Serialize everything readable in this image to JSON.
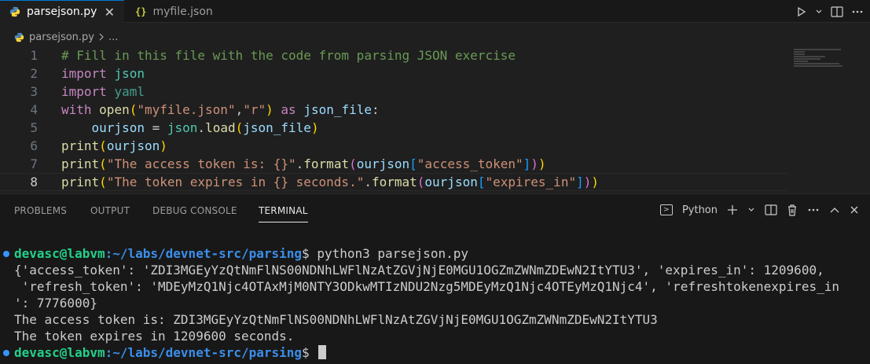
{
  "tabs": [
    {
      "label": "parsejson.py",
      "icon": "python-icon",
      "active": true,
      "close": "✕"
    },
    {
      "label": "myfile.json",
      "icon": "json-icon",
      "icon_glyph": "{}",
      "active": false
    }
  ],
  "breadcrumb": {
    "file": "parsejson.py",
    "more": "..."
  },
  "editor": {
    "line_numbers": [
      "1",
      "2",
      "3",
      "4",
      "5",
      "6",
      "7",
      "8"
    ]
  },
  "panel": {
    "tabs": [
      "PROBLEMS",
      "OUTPUT",
      "DEBUG CONSOLE",
      "TERMINAL"
    ],
    "active_tab": "TERMINAL",
    "shell_label": "Python"
  },
  "terminal": {
    "prompt_user": "devasc@labvm",
    "prompt_path": ":~/labs/devnet-src/parsing",
    "prompt_symbol": "$",
    "command": " python3 parsejson.py",
    "output": [
      "{'access_token': 'ZDI3MGEyYzQtNmFlNS00NDNhLWFlNzAtZGVjNjE0MGU1OGZmZWNmZDEwN2ItYTU3', 'expires_in': 1209600,",
      " 'refresh_token': 'MDEyMzQ1Njc4OTAxMjM0NTY3ODkwMTIzNDU2Nzg5MDEyMzQ1Njc4OTEyMzQ1Njc4', 'refreshtokenexpires_in",
      "': 7776000}",
      "The access token is: ZDI3MGEyYzQtNmFlNS00NDNhLWFlNzAtZGVjNjE0MGU1OGZmZWNmZDEwN2ItYTU3",
      "The token expires in 1209600 seconds."
    ]
  },
  "colors": {
    "accent": "#0078d4",
    "success_dot": "#3794ff",
    "prompt_user": "#23d18b",
    "prompt_path": "#3b8eea"
  }
}
